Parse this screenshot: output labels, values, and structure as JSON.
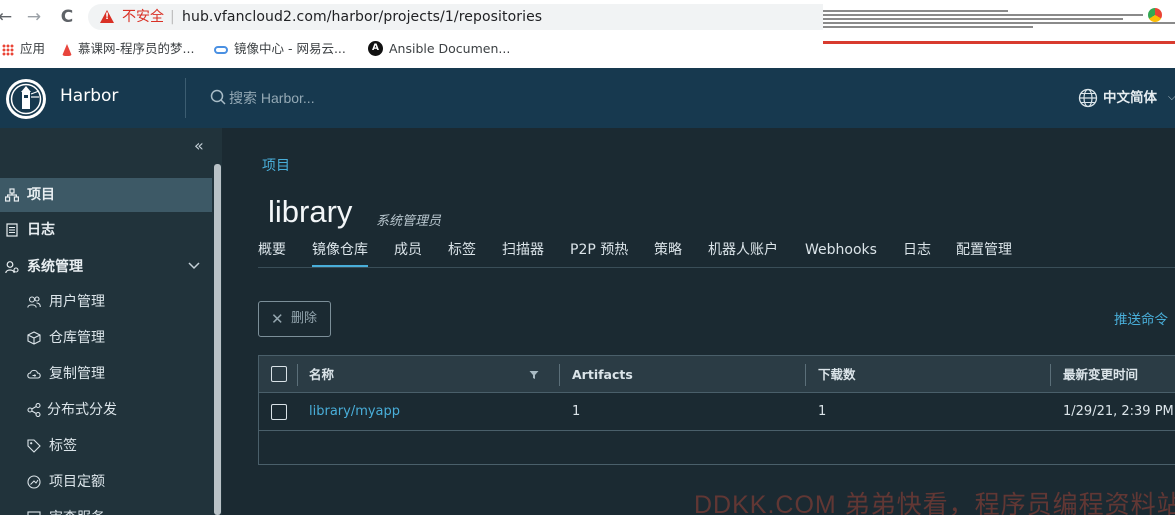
{
  "browser": {
    "back_glyph": "←",
    "forward_glyph": "→",
    "reload_glyph": "C",
    "security_label": "不安全",
    "separator": "|",
    "url": "hub.vfancloud2.com/harbor/projects/1/repositories",
    "bookmarks": [
      {
        "label": "应用",
        "icon": "apps-icon"
      },
      {
        "label": "慕课网-程序员的梦...",
        "icon": "fire-icon"
      },
      {
        "label": "镜像中心 - 网易云...",
        "icon": "cloud-icon"
      },
      {
        "label": "Ansible Documen...",
        "icon": "ansible-icon",
        "glyph": "A"
      }
    ]
  },
  "header": {
    "brand": "Harbor",
    "search_placeholder": "搜索 Harbor...",
    "language": "中文简体",
    "language_chevron": "⌵"
  },
  "sidebar": {
    "collapse_glyph": "«",
    "items": [
      {
        "label": "项目",
        "icon": "projects-icon",
        "level": "top",
        "active": true
      },
      {
        "label": "日志",
        "icon": "logs-icon",
        "level": "top"
      },
      {
        "label": "系统管理",
        "icon": "admin-icon",
        "level": "top",
        "expanded": true
      },
      {
        "label": "用户管理",
        "icon": "users-icon",
        "level": "sub"
      },
      {
        "label": "仓库管理",
        "icon": "registry-icon",
        "level": "sub"
      },
      {
        "label": "复制管理",
        "icon": "replication-icon",
        "level": "sub"
      },
      {
        "label": "分布式分发",
        "icon": "distribution-icon",
        "level": "sub"
      },
      {
        "label": "标签",
        "icon": "tag-icon",
        "level": "sub"
      },
      {
        "label": "项目定额",
        "icon": "quota-icon",
        "level": "sub"
      },
      {
        "label": "审查服务",
        "icon": "scanner-icon",
        "level": "sub"
      }
    ]
  },
  "main": {
    "breadcrumb": "项目",
    "project_name": "library",
    "role": "系统管理员",
    "tabs": [
      "概要",
      "镜像仓库",
      "成员",
      "标签",
      "扫描器",
      "P2P 预热",
      "策略",
      "机器人账户",
      "Webhooks",
      "日志",
      "配置管理"
    ],
    "active_tab": "镜像仓库",
    "delete_glyph": "✕",
    "delete_label": "删除",
    "push_command": "推送命令",
    "table": {
      "columns": [
        "名称",
        "Artifacts",
        "下载数",
        "最新变更时间"
      ],
      "rows": [
        {
          "name": "library/myapp",
          "artifacts": "1",
          "pulls": "1",
          "updated": "1/29/21, 2:39 PM"
        }
      ]
    }
  },
  "watermark": "DDKK.COM 弟弟快看，程序员编程资料站",
  "colors": {
    "header_bg": "#17394f",
    "sidebar_bg": "#21333b",
    "main_bg": "#1b2a32",
    "accent": "#49aed9",
    "insecure_red": "#d93025"
  }
}
